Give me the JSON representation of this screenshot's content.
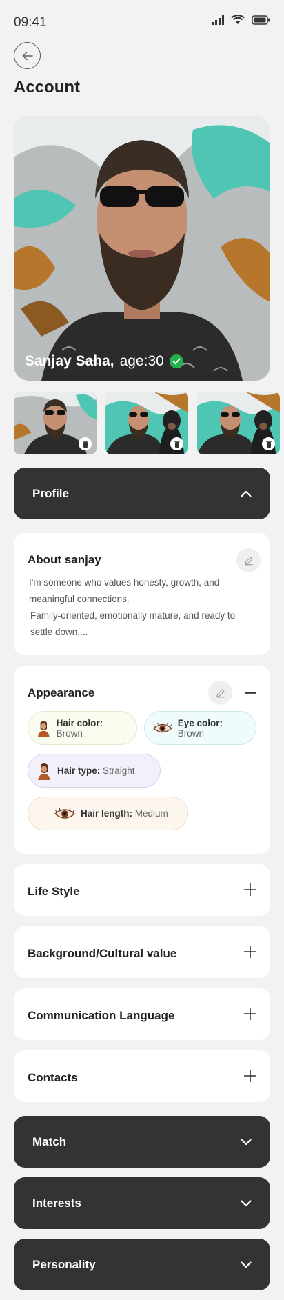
{
  "status": {
    "time": "09:41"
  },
  "page_title": "Account",
  "profile": {
    "name": "Sanjay Saha,",
    "age": "age:30"
  },
  "sections": {
    "profile": "Profile",
    "about_title": "About sanjay",
    "about_text_1": "I'm someone who values honesty, growth, and meaningful connections.",
    "about_text_2": "Family-oriented, emotionally mature, and ready to settle down....",
    "appearance_title": "Appearance",
    "lifestyle": "Life Style",
    "background": "Background/Cultural value",
    "communication": "Communication Language",
    "contacts": "Contacts",
    "match": "Match",
    "interests": "Interests",
    "personality": "Personality"
  },
  "appearance": [
    {
      "key": "Hair color:",
      "value": " Brown",
      "icon": "hair-icon",
      "bg": "#f9fdf0",
      "border": "#dde8cc"
    },
    {
      "key": "Eye color:",
      "value": " Brown",
      "icon": "eye-icon",
      "bg": "#f0fbfb",
      "border": "#c9e8e6"
    },
    {
      "key": "Hair type:",
      "value": " Straight",
      "icon": "hair-icon",
      "bg": "#f1f0fb",
      "border": "#d6d3ee"
    },
    {
      "key": "Hair length:",
      "value": " Medium",
      "icon": "eye-icon",
      "bg": "#fdf6ee",
      "border": "#ecdcc6"
    }
  ],
  "colors": {
    "dark_bar": "#333333",
    "verified": "#22b14c",
    "background": "#f2f2f2"
  }
}
